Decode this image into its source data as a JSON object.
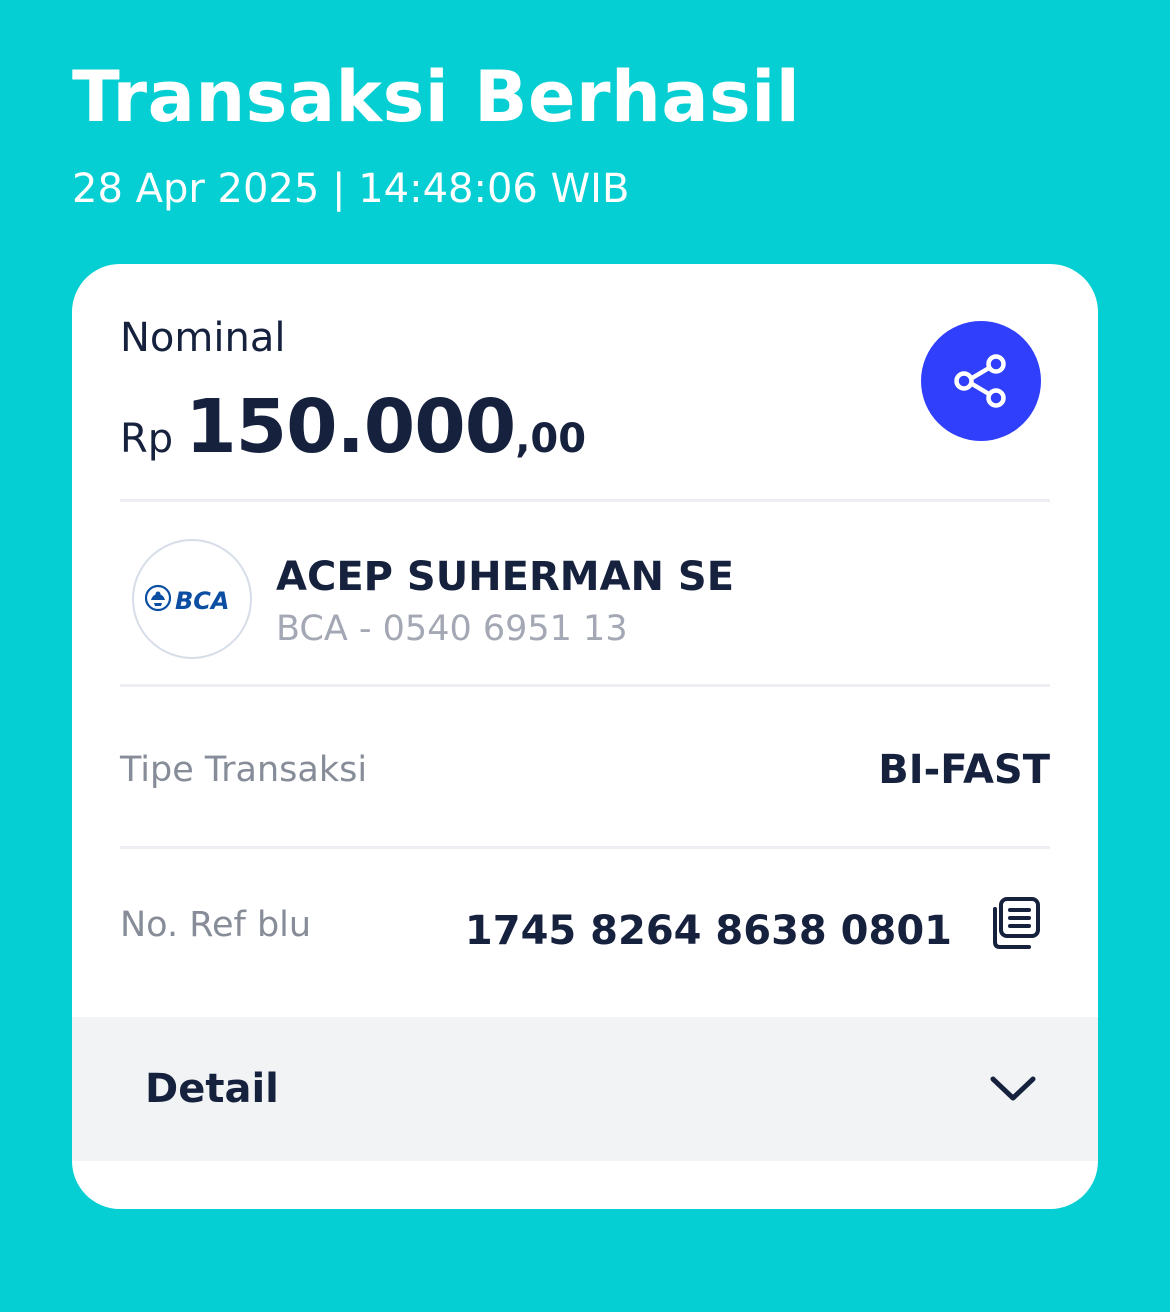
{
  "header": {
    "title": "Transaksi Berhasil",
    "datetime": "28 Apr 2025 | 14:48:06 WIB"
  },
  "nominal": {
    "label": "Nominal",
    "currency": "Rp",
    "amount": "150.000",
    "decimals": ",00"
  },
  "share": {
    "icon": "share-icon",
    "color": "#2F3FFC"
  },
  "recipient": {
    "bank_logo_text": "BCA",
    "name": "ACEP SUHERMAN SE",
    "account": "BCA - 0540 6951 13"
  },
  "transaction_type": {
    "label": "Tipe Transaksi",
    "value": "BI-FAST"
  },
  "reference": {
    "label": "No. Ref blu",
    "value": "1745 8264 8638 0801",
    "copy_icon": "copy-icon"
  },
  "detail": {
    "label": "Detail",
    "icon": "chevron-down-icon"
  },
  "colors": {
    "background": "#05CFD3",
    "card": "#FFFFFF",
    "text_dark": "#16213E",
    "text_muted": "#868C98",
    "accent": "#2F3FFC"
  }
}
